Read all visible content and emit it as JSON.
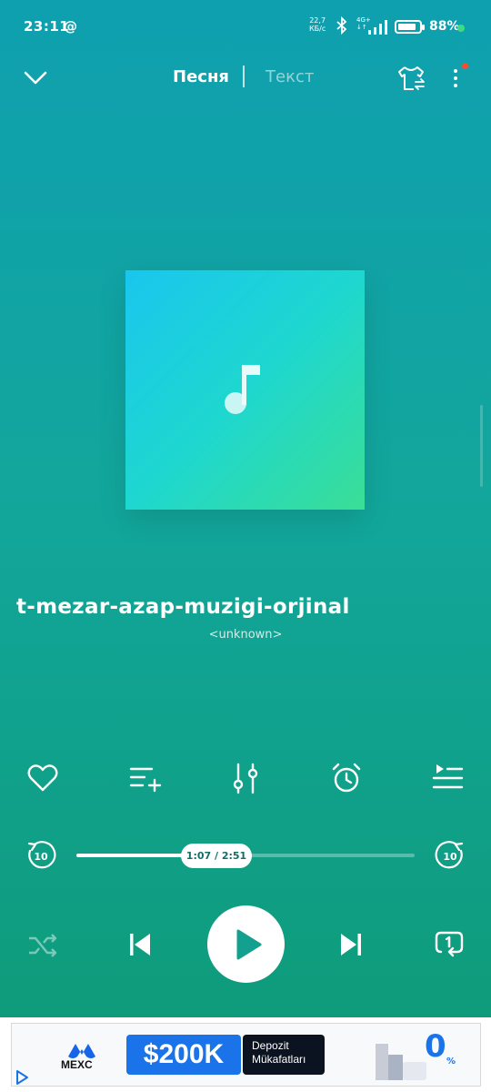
{
  "status": {
    "time": "23:11",
    "threads_glyph": "@",
    "speed_value": "22,7",
    "speed_unit": "КБ/с",
    "network_top": "4G+",
    "network_bottom": "↓↑",
    "battery_percent": "88%",
    "battery_level": 0.88,
    "dot_color": "#3ddc84"
  },
  "header": {
    "tab_song": "Песня",
    "tab_lyrics": "Текст",
    "icons": [
      "chevron-down-icon",
      "theme-shirt-icon",
      "more-vertical-icon"
    ],
    "notification_dot_color": "#ff4a2e"
  },
  "track": {
    "title": "t-mezar-azap-muzigi-orjinal",
    "artist": "<unknown>"
  },
  "actions": [
    "heart-icon",
    "add-to-playlist-icon",
    "equalizer-icon",
    "alarm-timer-icon",
    "queue-icon"
  ],
  "progress": {
    "time_label": "1:07 / 2:51",
    "fraction": 0.39,
    "rewind_label": "10",
    "forward_label": "10"
  },
  "controls": [
    "shuffle-icon",
    "previous-icon",
    "play-icon",
    "next-icon",
    "repeat-one-icon"
  ],
  "ad": {
    "brand": "MEXC",
    "amount": "$200K",
    "line1": "Depozit",
    "line2": "Mükafatları",
    "badge": "0",
    "badge_suffix": "%"
  },
  "colors": {
    "accent_text": "#126e66",
    "ad_blue": "#1a73e8"
  }
}
